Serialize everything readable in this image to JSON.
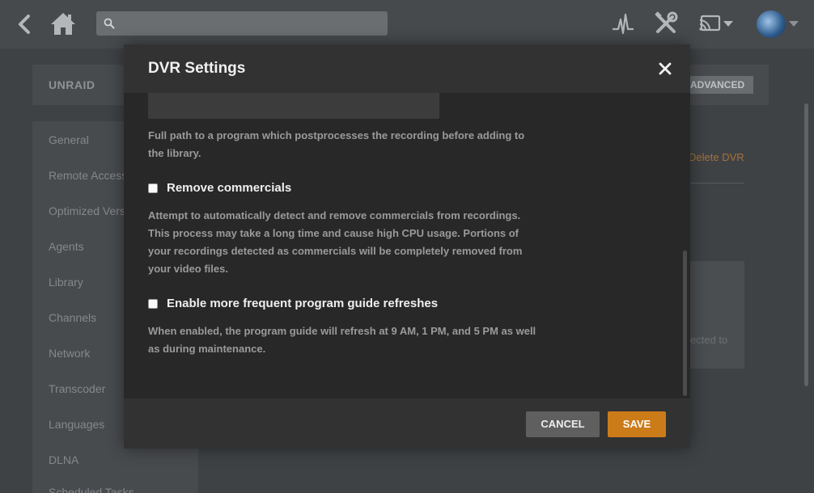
{
  "topbar": {
    "search": {
      "placeholder": "",
      "value": ""
    },
    "icons": {
      "back": "chevron-left-icon",
      "home": "home-icon",
      "activity": "activity-icon",
      "settings": "tools-icon",
      "cast": "cast-icon",
      "avatar": "user-avatar"
    }
  },
  "background": {
    "server_name": "UNRAID",
    "advanced_label": "ADVANCED",
    "delete_dvr": "Delete DVR",
    "panel_text": "ected to",
    "sidebar": [
      "General",
      "Remote Access",
      "Optimized Versions",
      "Agents",
      "Library",
      "Channels",
      "Network",
      "Transcoder",
      "Languages",
      "DLNA",
      "Scheduled Tasks"
    ]
  },
  "modal": {
    "title": "DVR Settings",
    "close_symbol": "✕",
    "postprocessing": {
      "path_value": "",
      "help": "Full path to a program which postprocesses the recording before adding to the library."
    },
    "remove_commercials": {
      "label": "Remove commercials",
      "checked": false,
      "help": "Attempt to automatically detect and remove commercials from recordings. This process may take a long time and cause high CPU usage. Portions of your recordings detected as commercials will be completely removed from your video files."
    },
    "guide_refresh": {
      "label": "Enable more frequent program guide refreshes",
      "checked": false,
      "help": "When enabled, the program guide will refresh at 9 AM, 1 PM, and 5 PM as well as during maintenance."
    },
    "cancel_label": "CANCEL",
    "save_label": "SAVE"
  },
  "colors": {
    "accent": "#cc7b19",
    "modal_bg": "#282828",
    "header_bg": "#323232",
    "page_bg": "#3f4245"
  }
}
